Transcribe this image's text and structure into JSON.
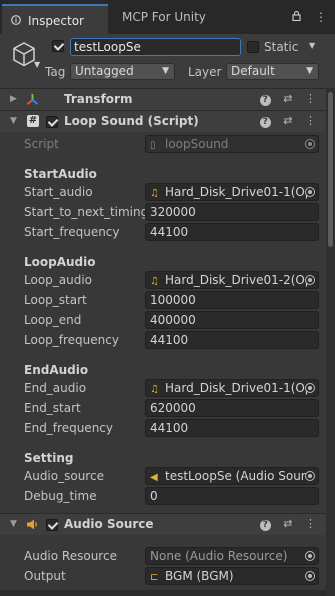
{
  "tabs": {
    "inspector": "Inspector",
    "mcp": "MCP For Unity"
  },
  "gameobject": {
    "name": "testLoopSe",
    "static_label": "Static",
    "tag_label": "Tag",
    "tag_value": "Untagged",
    "layer_label": "Layer",
    "layer_value": "Default"
  },
  "components": {
    "transform": {
      "title": "Transform"
    },
    "loop_sound": {
      "title": "Loop Sound (Script)",
      "script_label": "Script",
      "script_value": "loopSound",
      "sections": {
        "start": {
          "header": "StartAudio",
          "audio_label": "Start_audio",
          "audio_value": "Hard_Disk_Drive01-1(Op",
          "next_label": "Start_to_next_timing",
          "next_value": "320000",
          "freq_label": "Start_frequency",
          "freq_value": "44100"
        },
        "loop": {
          "header": "LoopAudio",
          "audio_label": "Loop_audio",
          "audio_value": "Hard_Disk_Drive01-2(Op",
          "start_label": "Loop_start",
          "start_value": "100000",
          "end_label": "Loop_end",
          "end_value": "400000",
          "freq_label": "Loop_frequency",
          "freq_value": "44100"
        },
        "end": {
          "header": "EndAudio",
          "audio_label": "End_audio",
          "audio_value": "Hard_Disk_Drive01-1(Op",
          "start_label": "End_start",
          "start_value": "620000",
          "freq_label": "End_frequency",
          "freq_value": "44100"
        },
        "setting": {
          "header": "Setting",
          "source_label": "Audio_source",
          "source_value": "testLoopSe (Audio Sourc",
          "debug_label": "Debug_time",
          "debug_value": "0"
        }
      }
    },
    "audio_source": {
      "title": "Audio Source",
      "resource_label": "Audio Resource",
      "resource_value": "None (Audio Resource)",
      "output_label": "Output",
      "output_value": "BGM (BGM)"
    }
  },
  "colors": {
    "accent": "#3a79bb",
    "panel": "#383838",
    "field": "#2a2a2a"
  }
}
